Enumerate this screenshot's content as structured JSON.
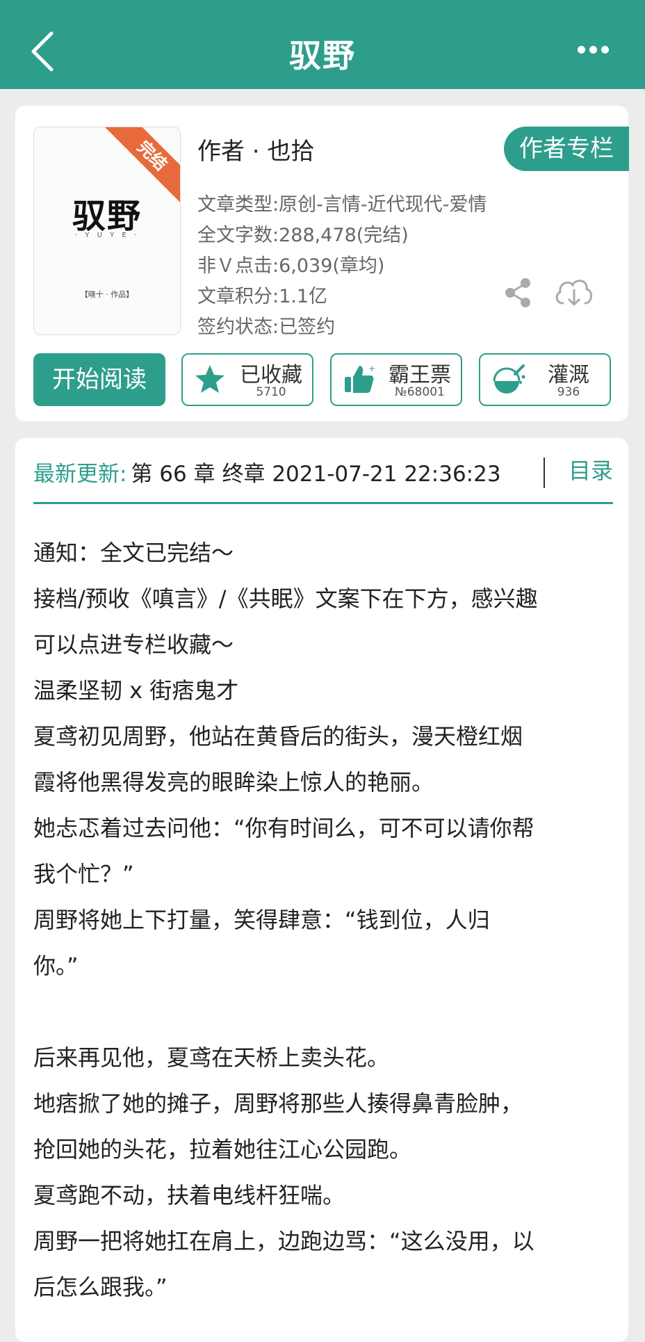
{
  "header": {
    "title": "驭野"
  },
  "book": {
    "cover": {
      "title": "驭野",
      "subtitle": "· Y U Y E ·",
      "author_stamp": "【晓十 · 作品】",
      "ribbon": "完结"
    },
    "author_line": "作者 · 也拾",
    "column_button": "作者专栏",
    "meta": [
      "文章类型:原创-言情-近代现代-爱情",
      "全文字数:288,478(完结)",
      "非Ｖ点击:6,039(章均)",
      "文章积分:1.1亿",
      "签约状态:已签约"
    ]
  },
  "actions": {
    "start_reading": "开始阅读",
    "collect": {
      "label": "已收藏",
      "count": "5710"
    },
    "ticket": {
      "label": "霸王票",
      "count": "№68001"
    },
    "water": {
      "label": "灌溉",
      "count": "936"
    }
  },
  "update": {
    "label": "最新更新:",
    "text": "第 66 章  终章  2021-07-21 22:36:23",
    "toc": "目录"
  },
  "description": [
    "通知：全文已完结～",
    "接档/预收《嗔言》/《共眠》文案下在下方，感兴趣",
    "可以点进专栏收藏～",
    "温柔坚韧 x 街痞鬼才",
    "夏鸢初见周野，他站在黄昏后的街头，漫天橙红烟",
    "霞将他黑得发亮的眼眸染上惊人的艳丽。",
    "她忐忑着过去问他：“你有时间么，可不可以请你帮",
    "我个忙？”",
    "周野将她上下打量，笑得肆意：“钱到位，人归",
    "你。”",
    "",
    "后来再见他，夏鸢在天桥上卖头花。",
    "地痞掀了她的摊子，周野将那些人揍得鼻青脸肿，",
    "抢回她的头花，拉着她往江心公园跑。",
    "夏鸢跑不动，扶着电线杆狂喘。",
    "周野一把将她扛在肩上，边跑边骂：“这么没用，以",
    "后怎么跟我。”"
  ],
  "colors": {
    "accent": "#2e9e8c",
    "ribbon": "#e86a3c"
  }
}
